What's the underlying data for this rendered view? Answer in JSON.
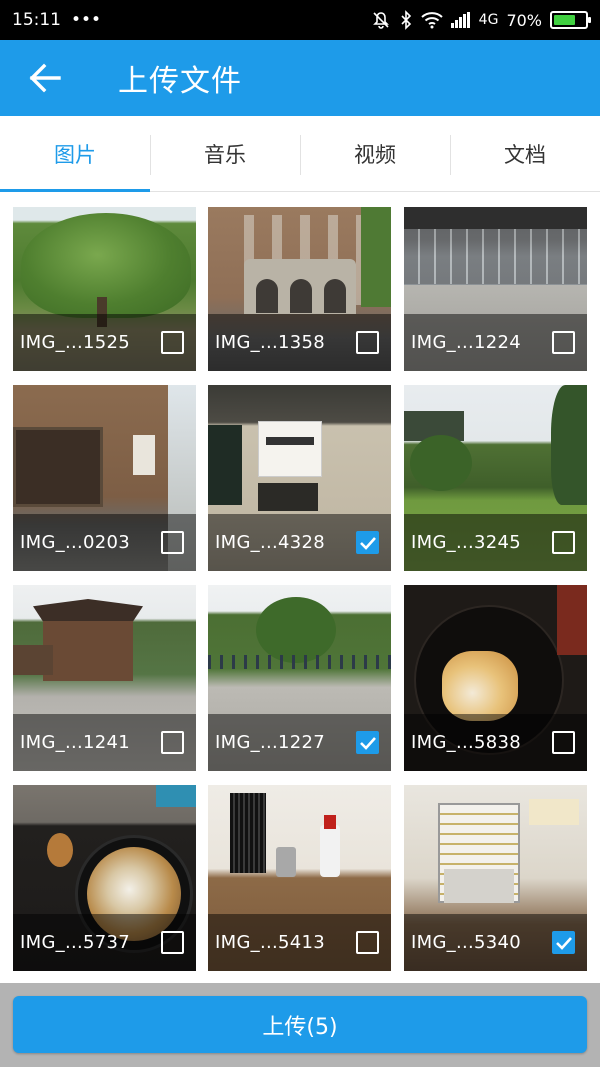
{
  "status_bar": {
    "time": "15:11",
    "more": "•••",
    "network": "4G",
    "battery": "70%",
    "battery_level": 0.7
  },
  "header": {
    "title": "上传文件",
    "back_icon": "arrow-left-icon"
  },
  "tabs": [
    {
      "label": "图片",
      "active": true
    },
    {
      "label": "音乐",
      "active": false
    },
    {
      "label": "视频",
      "active": false
    },
    {
      "label": "文档",
      "active": false
    }
  ],
  "photos": [
    {
      "name": "IMG_...1525",
      "checked": false
    },
    {
      "name": "IMG_...1358",
      "checked": false
    },
    {
      "name": "IMG_...1224",
      "checked": false
    },
    {
      "name": "IMG_...0203",
      "checked": false
    },
    {
      "name": "IMG_...4328",
      "checked": true
    },
    {
      "name": "IMG_...3245",
      "checked": false
    },
    {
      "name": "IMG_...1241",
      "checked": false
    },
    {
      "name": "IMG_...1227",
      "checked": true
    },
    {
      "name": "IMG_...5838",
      "checked": false
    },
    {
      "name": "IMG_...5737",
      "checked": false
    },
    {
      "name": "IMG_...5413",
      "checked": false
    },
    {
      "name": "IMG_...5340",
      "checked": true
    }
  ],
  "upload_button": {
    "label": "上传(5)"
  },
  "colors": {
    "accent": "#1e9be9",
    "status_bar": "#000000",
    "bottom_bar": "#b3b3b3"
  }
}
